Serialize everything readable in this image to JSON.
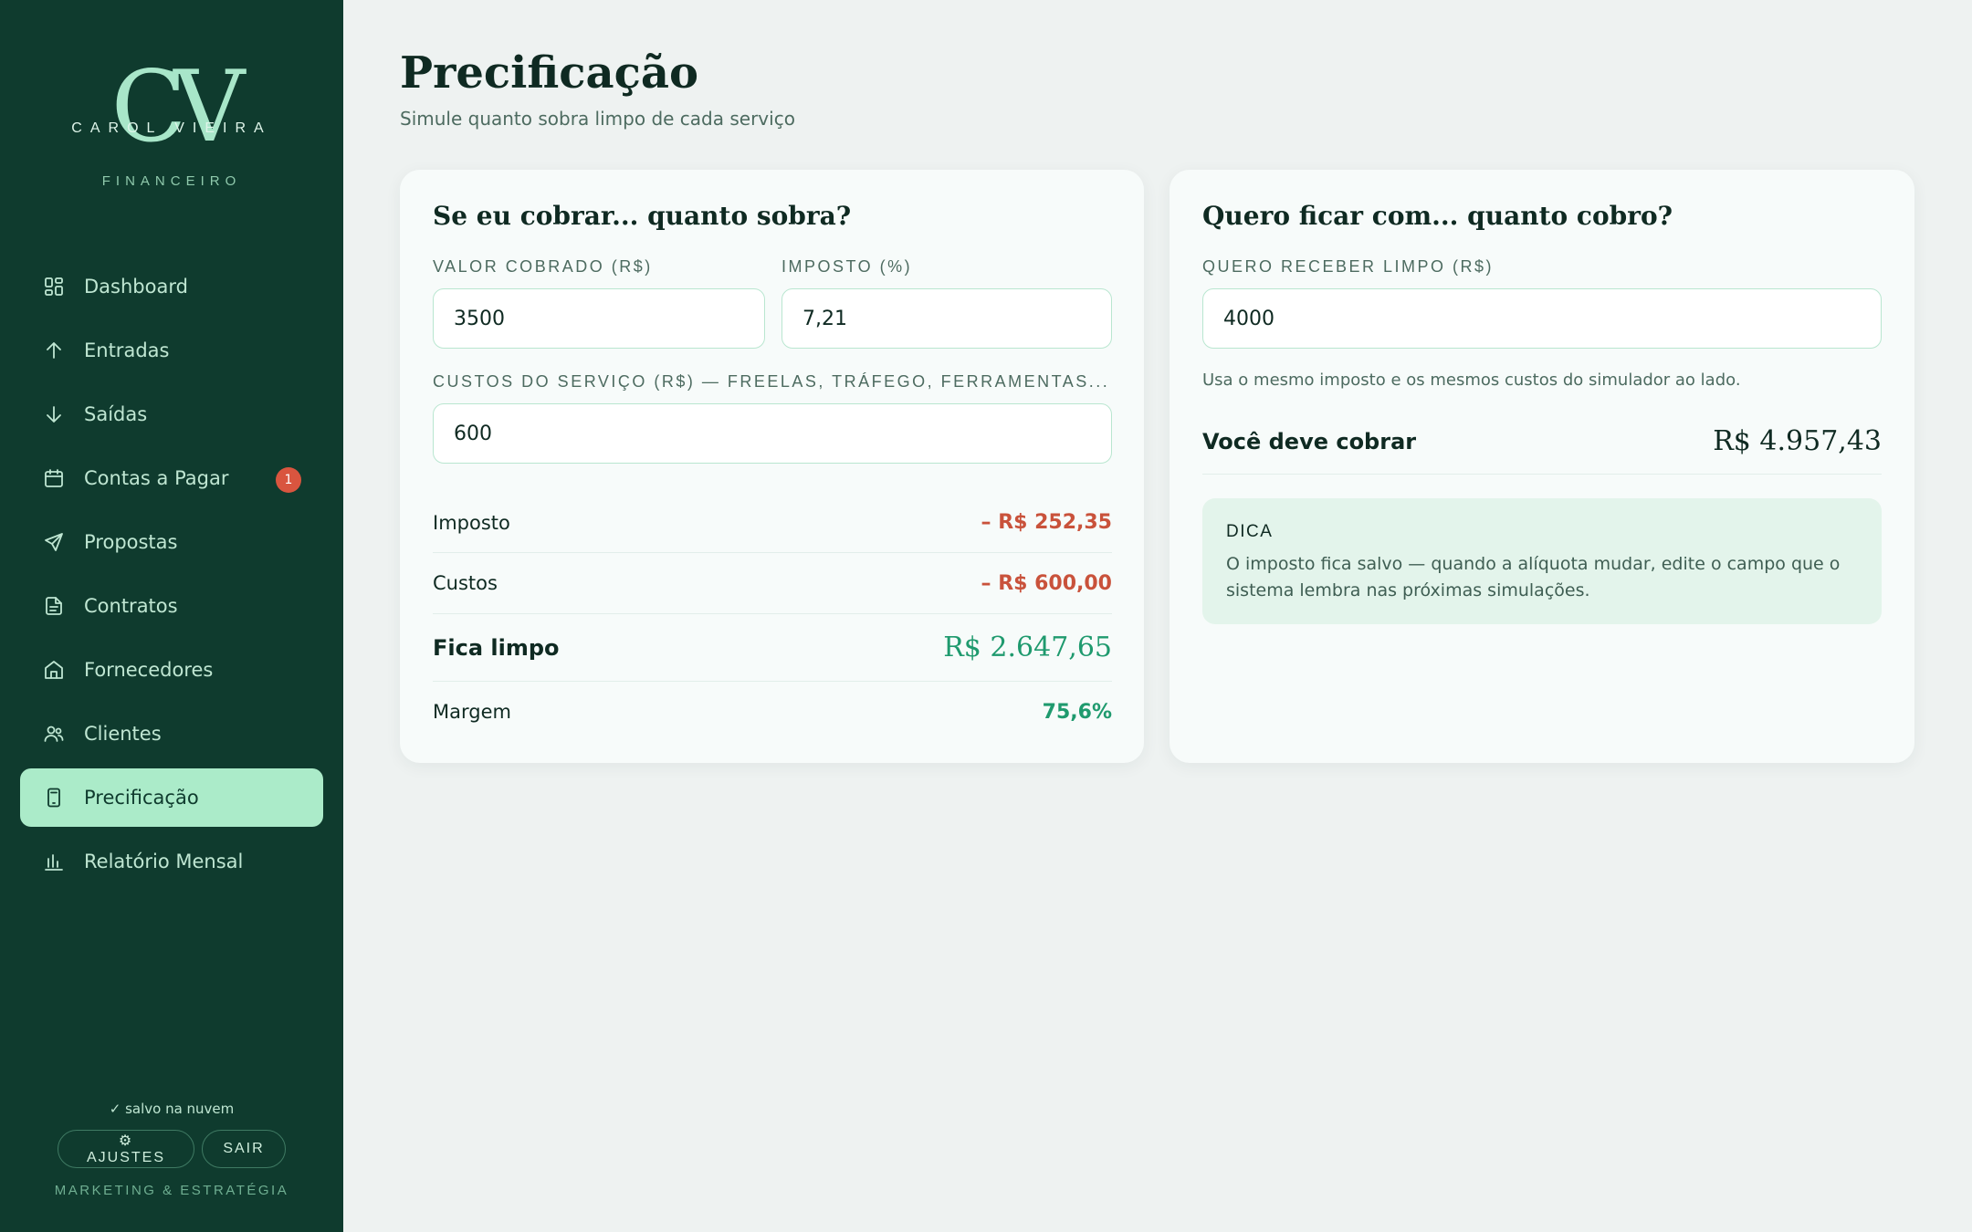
{
  "brand": {
    "monogram": "CV",
    "name": "CAROL VIEIRA",
    "subtitle": "FINANCEIRO"
  },
  "sidebar": {
    "items": [
      {
        "label": "Dashboard",
        "icon": "dashboard-grid-icon"
      },
      {
        "label": "Entradas",
        "icon": "arrow-up-icon"
      },
      {
        "label": "Saídas",
        "icon": "arrow-down-icon"
      },
      {
        "label": "Contas a Pagar",
        "icon": "calendar-icon",
        "badge": "1"
      },
      {
        "label": "Propostas",
        "icon": "send-icon"
      },
      {
        "label": "Contratos",
        "icon": "document-icon"
      },
      {
        "label": "Fornecedores",
        "icon": "store-icon"
      },
      {
        "label": "Clientes",
        "icon": "users-icon"
      },
      {
        "label": "Precificação",
        "icon": "calculator-icon",
        "active": true
      },
      {
        "label": "Relatório Mensal",
        "icon": "bar-chart-icon"
      }
    ],
    "footer": {
      "saved": "✓ salvo na nuvem",
      "settings_label": "⚙ AJUSTES",
      "logout_label": "SAIR",
      "tagline": "MARKETING & ESTRATÉGIA"
    }
  },
  "page": {
    "title": "Precificação",
    "subtitle": "Simule quanto sobra limpo de cada serviço"
  },
  "simulator": {
    "title": "Se eu cobrar... quanto sobra?",
    "charged_label": "VALOR COBRADO (R$)",
    "charged_value": "3500",
    "tax_label": "IMPOSTO (%)",
    "tax_value": "7,21",
    "costs_label": "CUSTOS DO SERVIÇO (R$) — FREELAS, TRÁFEGO, FERRAMENTAS...",
    "costs_value": "600",
    "results": {
      "tax_label": "Imposto",
      "tax_value": "– R$ 252,35",
      "costs_label": "Custos",
      "costs_value": "– R$ 600,00",
      "net_label": "Fica limpo",
      "net_value": "R$ 2.647,65",
      "margin_label": "Margem",
      "margin_value": "75,6%"
    }
  },
  "reverse": {
    "title": "Quero ficar com... quanto cobro?",
    "target_label": "QUERO RECEBER LIMPO (R$)",
    "target_value": "4000",
    "note": "Usa o mesmo imposto e os mesmos custos do simulador ao lado.",
    "result_label": "Você deve cobrar",
    "result_value": "R$ 4.957,43",
    "tip_title": "DICA",
    "tip_text": "O imposto fica salvo — quando a alíquota mudar, edite o campo que o sistema lembra nas próximas simulações."
  },
  "colors": {
    "sidebar_bg": "#0f3b2e",
    "active_bg": "#abebc9",
    "negative": "#c9523b",
    "positive": "#1f9a6e",
    "badge": "#d9553f"
  }
}
